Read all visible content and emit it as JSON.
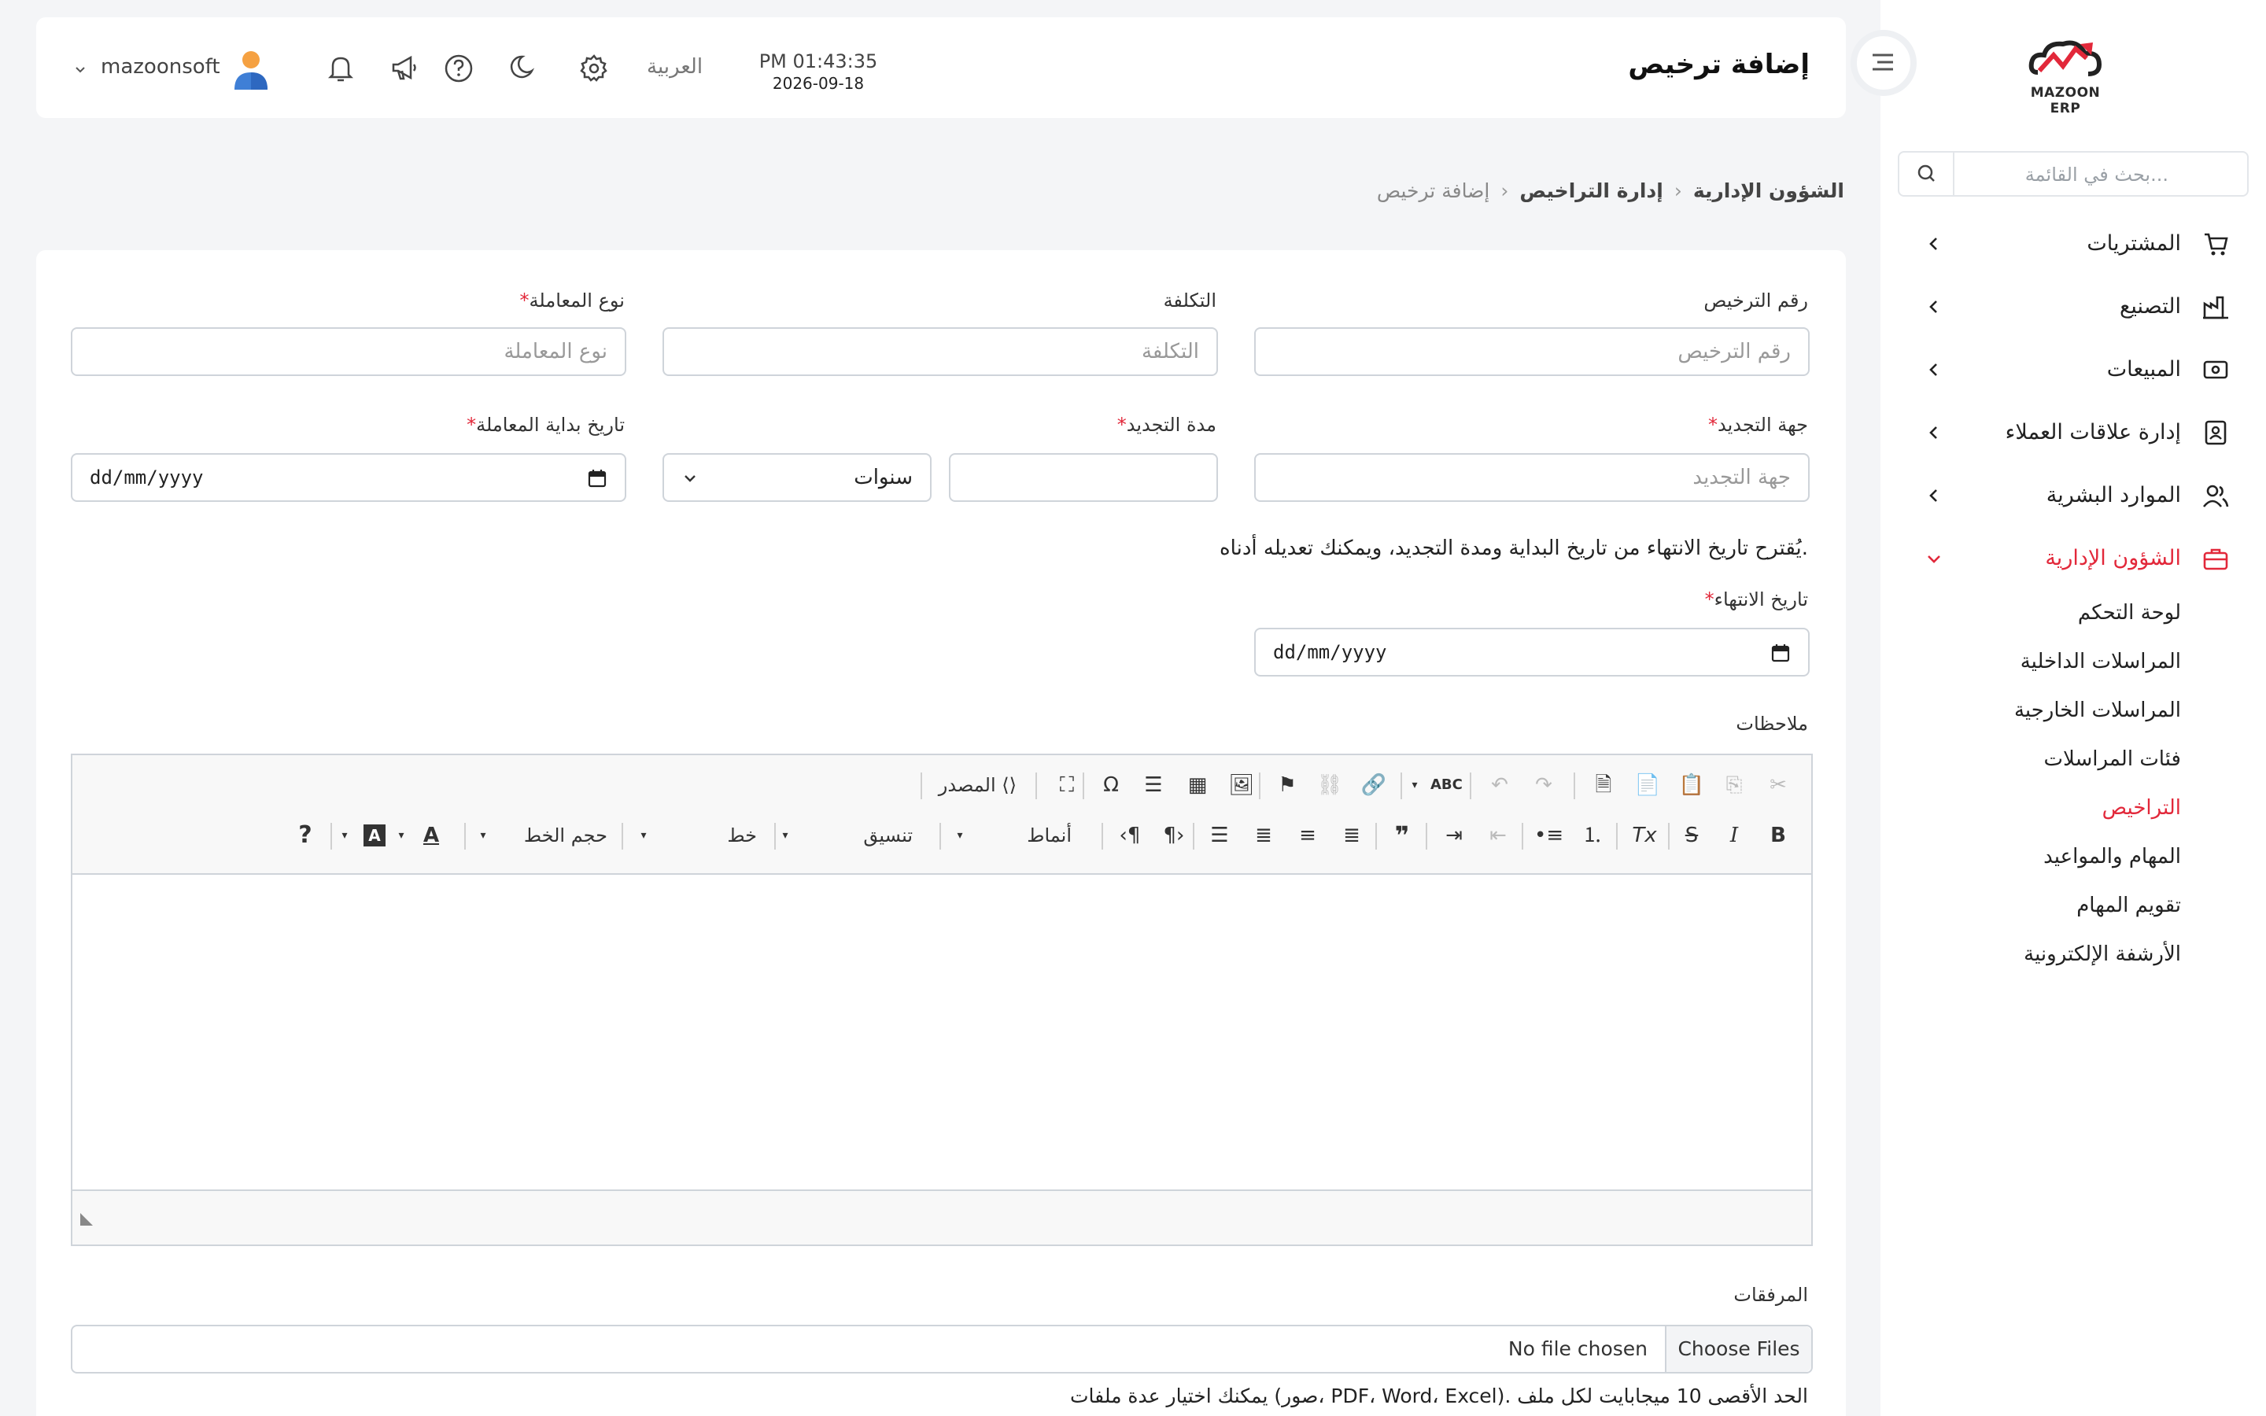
{
  "sidebar": {
    "logo_text": "MAZOON ERP",
    "search_placeholder": "بحث في القائمة...",
    "items": [
      {
        "label": "المشتريات",
        "icon": "cart-icon"
      },
      {
        "label": "التصنيع",
        "icon": "factory-icon"
      },
      {
        "label": "المبيعات",
        "icon": "cash-register-icon"
      },
      {
        "label": "إدارة علاقات العملاء",
        "icon": "address-book-icon"
      },
      {
        "label": "الموارد البشرية",
        "icon": "users-icon"
      },
      {
        "label": "الشؤون الإدارية",
        "icon": "briefcase-icon"
      }
    ],
    "submenu": [
      {
        "label": "لوحة التحكم"
      },
      {
        "label": "المراسلات الداخلية"
      },
      {
        "label": "المراسلات الخارجية"
      },
      {
        "label": "فئات المراسلات"
      },
      {
        "label": "التراخيص"
      },
      {
        "label": "المهام والمواعيد"
      },
      {
        "label": "تقويم المهام"
      },
      {
        "label": "الأرشفة الإلكترونية"
      }
    ]
  },
  "header": {
    "title": "إضافة ترخيص",
    "time": "PM 01:43:35",
    "date": "2026-09-18",
    "language": "العربية",
    "username": "mazoonsoft"
  },
  "breadcrumb": [
    "الشؤون الإدارية",
    "إدارة التراخيص",
    "إضافة ترخيص"
  ],
  "form": {
    "license_number": {
      "label": "رقم الترخيص",
      "placeholder": "رقم الترخيص"
    },
    "cost": {
      "label": "التكلفة",
      "placeholder": "التكلفة"
    },
    "transaction_type": {
      "label": "نوع المعاملة",
      "placeholder": "نوع المعاملة"
    },
    "renewal_authority": {
      "label": "جهة التجديد",
      "placeholder": "جهة التجديد"
    },
    "renewal_period": {
      "label": "مدة التجديد",
      "unit": "سنوات"
    },
    "start_date": {
      "label": "تاريخ بداية المعاملة",
      "value": "dd/mm/yyyy"
    },
    "hint": "يُقترح تاريخ الانتهاء من تاريخ البداية ومدة التجديد، ويمكنك تعديله أدناه.",
    "end_date": {
      "label": "تاريخ الانتهاء",
      "value": "dd/mm/yyyy"
    },
    "notes_label": "ملاحظات",
    "attachments_label": "المرفقات",
    "choose_files": "Choose Files",
    "no_file": "No file chosen",
    "attachments_hint": "يمكنك اختيار عدة ملفات (صور، PDF، Word، Excel). الحد الأقصى 10 ميجابايت لكل ملف"
  },
  "editor": {
    "source_label": "المصدر",
    "styles_label": "أنماط",
    "format_label": "تنسيق",
    "font_label": "خط",
    "size_label": "حجم الخط",
    "help_label": "?"
  },
  "colors": {
    "accent": "#e2283a",
    "border": "#cfd4da"
  }
}
